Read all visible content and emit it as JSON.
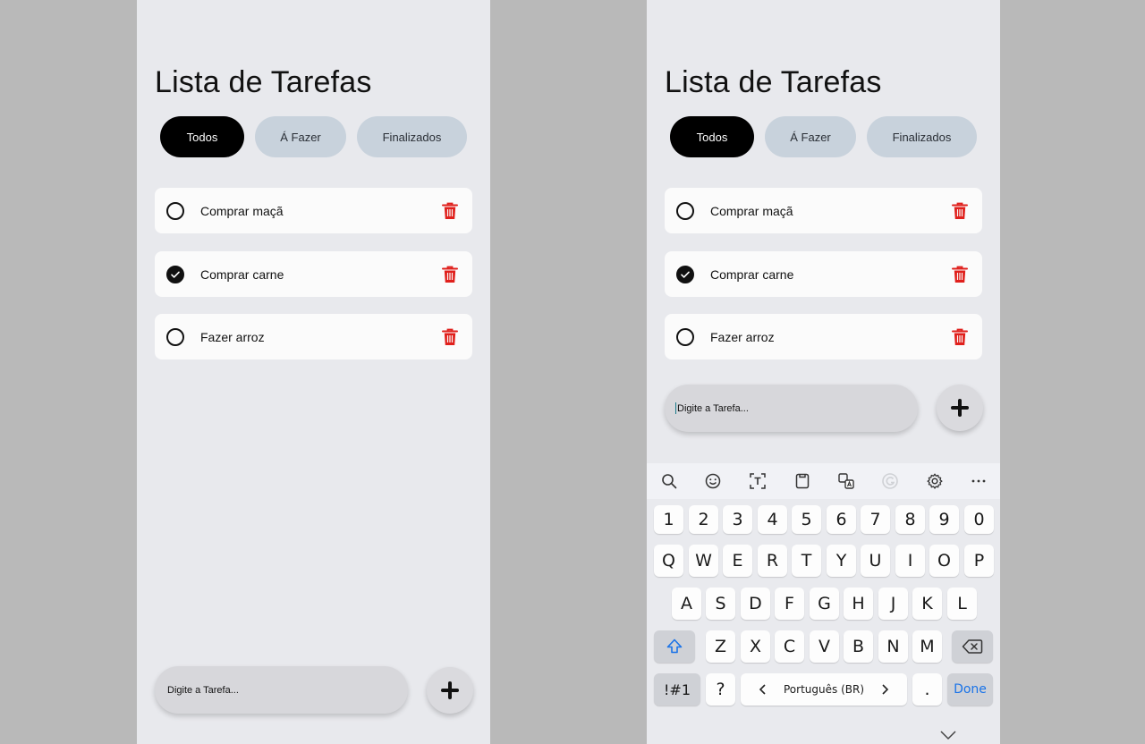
{
  "app": {
    "title": "Lista de Tarefas",
    "filters": [
      "Todos",
      "Á Fazer",
      "Finalizados"
    ],
    "active_filter": "Todos",
    "tasks": [
      {
        "label": "Comprar maçã",
        "done": false
      },
      {
        "label": "Comprar carne",
        "done": true
      },
      {
        "label": "Fazer arroz",
        "done": false
      }
    ],
    "input_placeholder": "Digite a Tarefa..."
  },
  "keyboard": {
    "toolbar_icons": [
      "search-icon",
      "emoji-icon",
      "text-recognition-icon",
      "clipboard-icon",
      "translate-icon",
      "grammarly-icon",
      "settings-icon",
      "more-icon"
    ],
    "row_numbers": [
      "1",
      "2",
      "3",
      "4",
      "5",
      "6",
      "7",
      "8",
      "9",
      "0"
    ],
    "row_1": [
      "Q",
      "W",
      "E",
      "R",
      "T",
      "Y",
      "U",
      "I",
      "O",
      "P"
    ],
    "row_2": [
      "A",
      "S",
      "D",
      "F",
      "G",
      "H",
      "J",
      "K",
      "L"
    ],
    "row_3": [
      "Z",
      "X",
      "C",
      "V",
      "B",
      "N",
      "M"
    ],
    "symbols_label": "!#1",
    "question_label": "?",
    "space_label": "Português (BR)",
    "period_label": ".",
    "done_label": "Done"
  },
  "colors": {
    "background": "#b9b9b9",
    "screen": "#e8e9ed",
    "active_filter": "#000000",
    "inactive_filter": "#c8d2dc",
    "trash": "#e0201c",
    "done_key": "#1a73e8",
    "shift": "#1a73e8"
  }
}
